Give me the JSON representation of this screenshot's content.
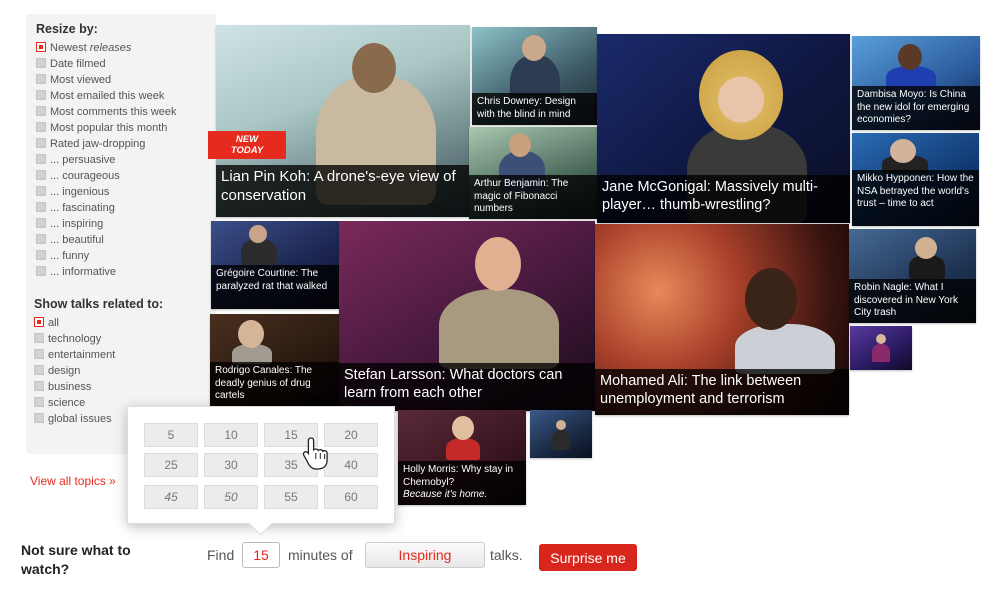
{
  "sidebar": {
    "resize_heading": "Resize by:",
    "resize_options": [
      {
        "label": "Newest",
        "label_em": "releases",
        "selected": true
      },
      {
        "label": "Date filmed"
      },
      {
        "label": "Most viewed"
      },
      {
        "label": "Most emailed this week"
      },
      {
        "label": "Most comments this week"
      },
      {
        "label": "Most popular this month"
      },
      {
        "label": "Rated jaw-dropping"
      },
      {
        "label": "... persuasive"
      },
      {
        "label": "... courageous"
      },
      {
        "label": "... ingenious"
      },
      {
        "label": "... fascinating"
      },
      {
        "label": "... inspiring"
      },
      {
        "label": "... beautiful"
      },
      {
        "label": "... funny"
      },
      {
        "label": "... informative"
      }
    ],
    "topics_heading": "Show talks related to:",
    "topic_options": [
      {
        "label": "all",
        "selected": true
      },
      {
        "label": "technology"
      },
      {
        "label": "entertainment"
      },
      {
        "label": "design"
      },
      {
        "label": "business"
      },
      {
        "label": "science"
      },
      {
        "label": "global issues"
      }
    ],
    "view_all": "View all topics »"
  },
  "badge": {
    "line1": "NEW",
    "line2": "TODAY"
  },
  "tiles": [
    {
      "title": "Lian Pin Koh: A drone's-eye view of conservation"
    },
    {
      "title": "Chris Downey: Design with the blind in mind"
    },
    {
      "title": "Arthur Benjamin: The magic of Fibonacci numbers"
    },
    {
      "title": "Jane McGonigal: Massively multi-player… thumb-wrestling?"
    },
    {
      "title": "Dambisa Moyo: Is China the new idol for emerging economies?"
    },
    {
      "title": "Mikko Hypponen: How the NSA betrayed the world's trust – time to act"
    },
    {
      "title": "Grégoire Courtine: The paralyzed rat that walked"
    },
    {
      "title": "Stefan Larsson: What doctors can learn from each other"
    },
    {
      "title": "Mohamed Ali: The link between unemployment and terrorism"
    },
    {
      "title": "Robin Nagle: What I discovered in New York City trash"
    },
    {
      "title": "Rodrigo Canales: The deadly genius of drug cartels"
    },
    {
      "title": "Holly Morris: Why stay in Chernobyl?",
      "subtitle": "Because it's home."
    },
    {
      "title": ""
    },
    {
      "title": ""
    }
  ],
  "time_options": [
    "5",
    "10",
    "15",
    "20",
    "25",
    "30",
    "35",
    "40",
    "45",
    "50",
    "55",
    "60"
  ],
  "bottom": {
    "not_sure": "Not sure what to watch?",
    "find": "Find",
    "minutes_value": "15",
    "minutes_of": "minutes of",
    "mood_value": "Inspiring",
    "talks": "talks.",
    "surprise": "Surprise me"
  },
  "colors": {
    "accent": "#e62b1e",
    "caption_bg": "#000000"
  }
}
